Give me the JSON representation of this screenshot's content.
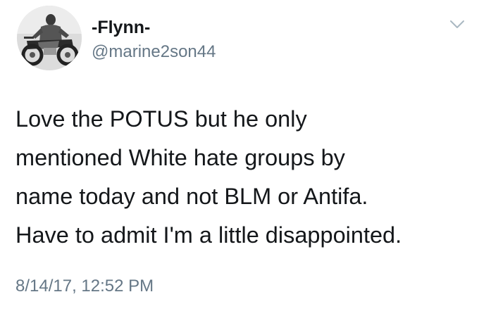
{
  "user": {
    "display_name": "-Flynn-",
    "handle": "@marine2son44"
  },
  "tweet": {
    "lines": [
      "Love the POTUS but he only",
      "mentioned White hate groups by",
      "name today and not BLM or Antifa.",
      "Have to admit I'm a little disappointed."
    ],
    "timestamp": "8/14/17, 12:52 PM"
  },
  "icons": {
    "menu": "chevron-down-icon",
    "avatar": "avatar"
  },
  "colors": {
    "text": "#14171a",
    "secondary": "#657786",
    "chevron": "#aab8c2"
  }
}
